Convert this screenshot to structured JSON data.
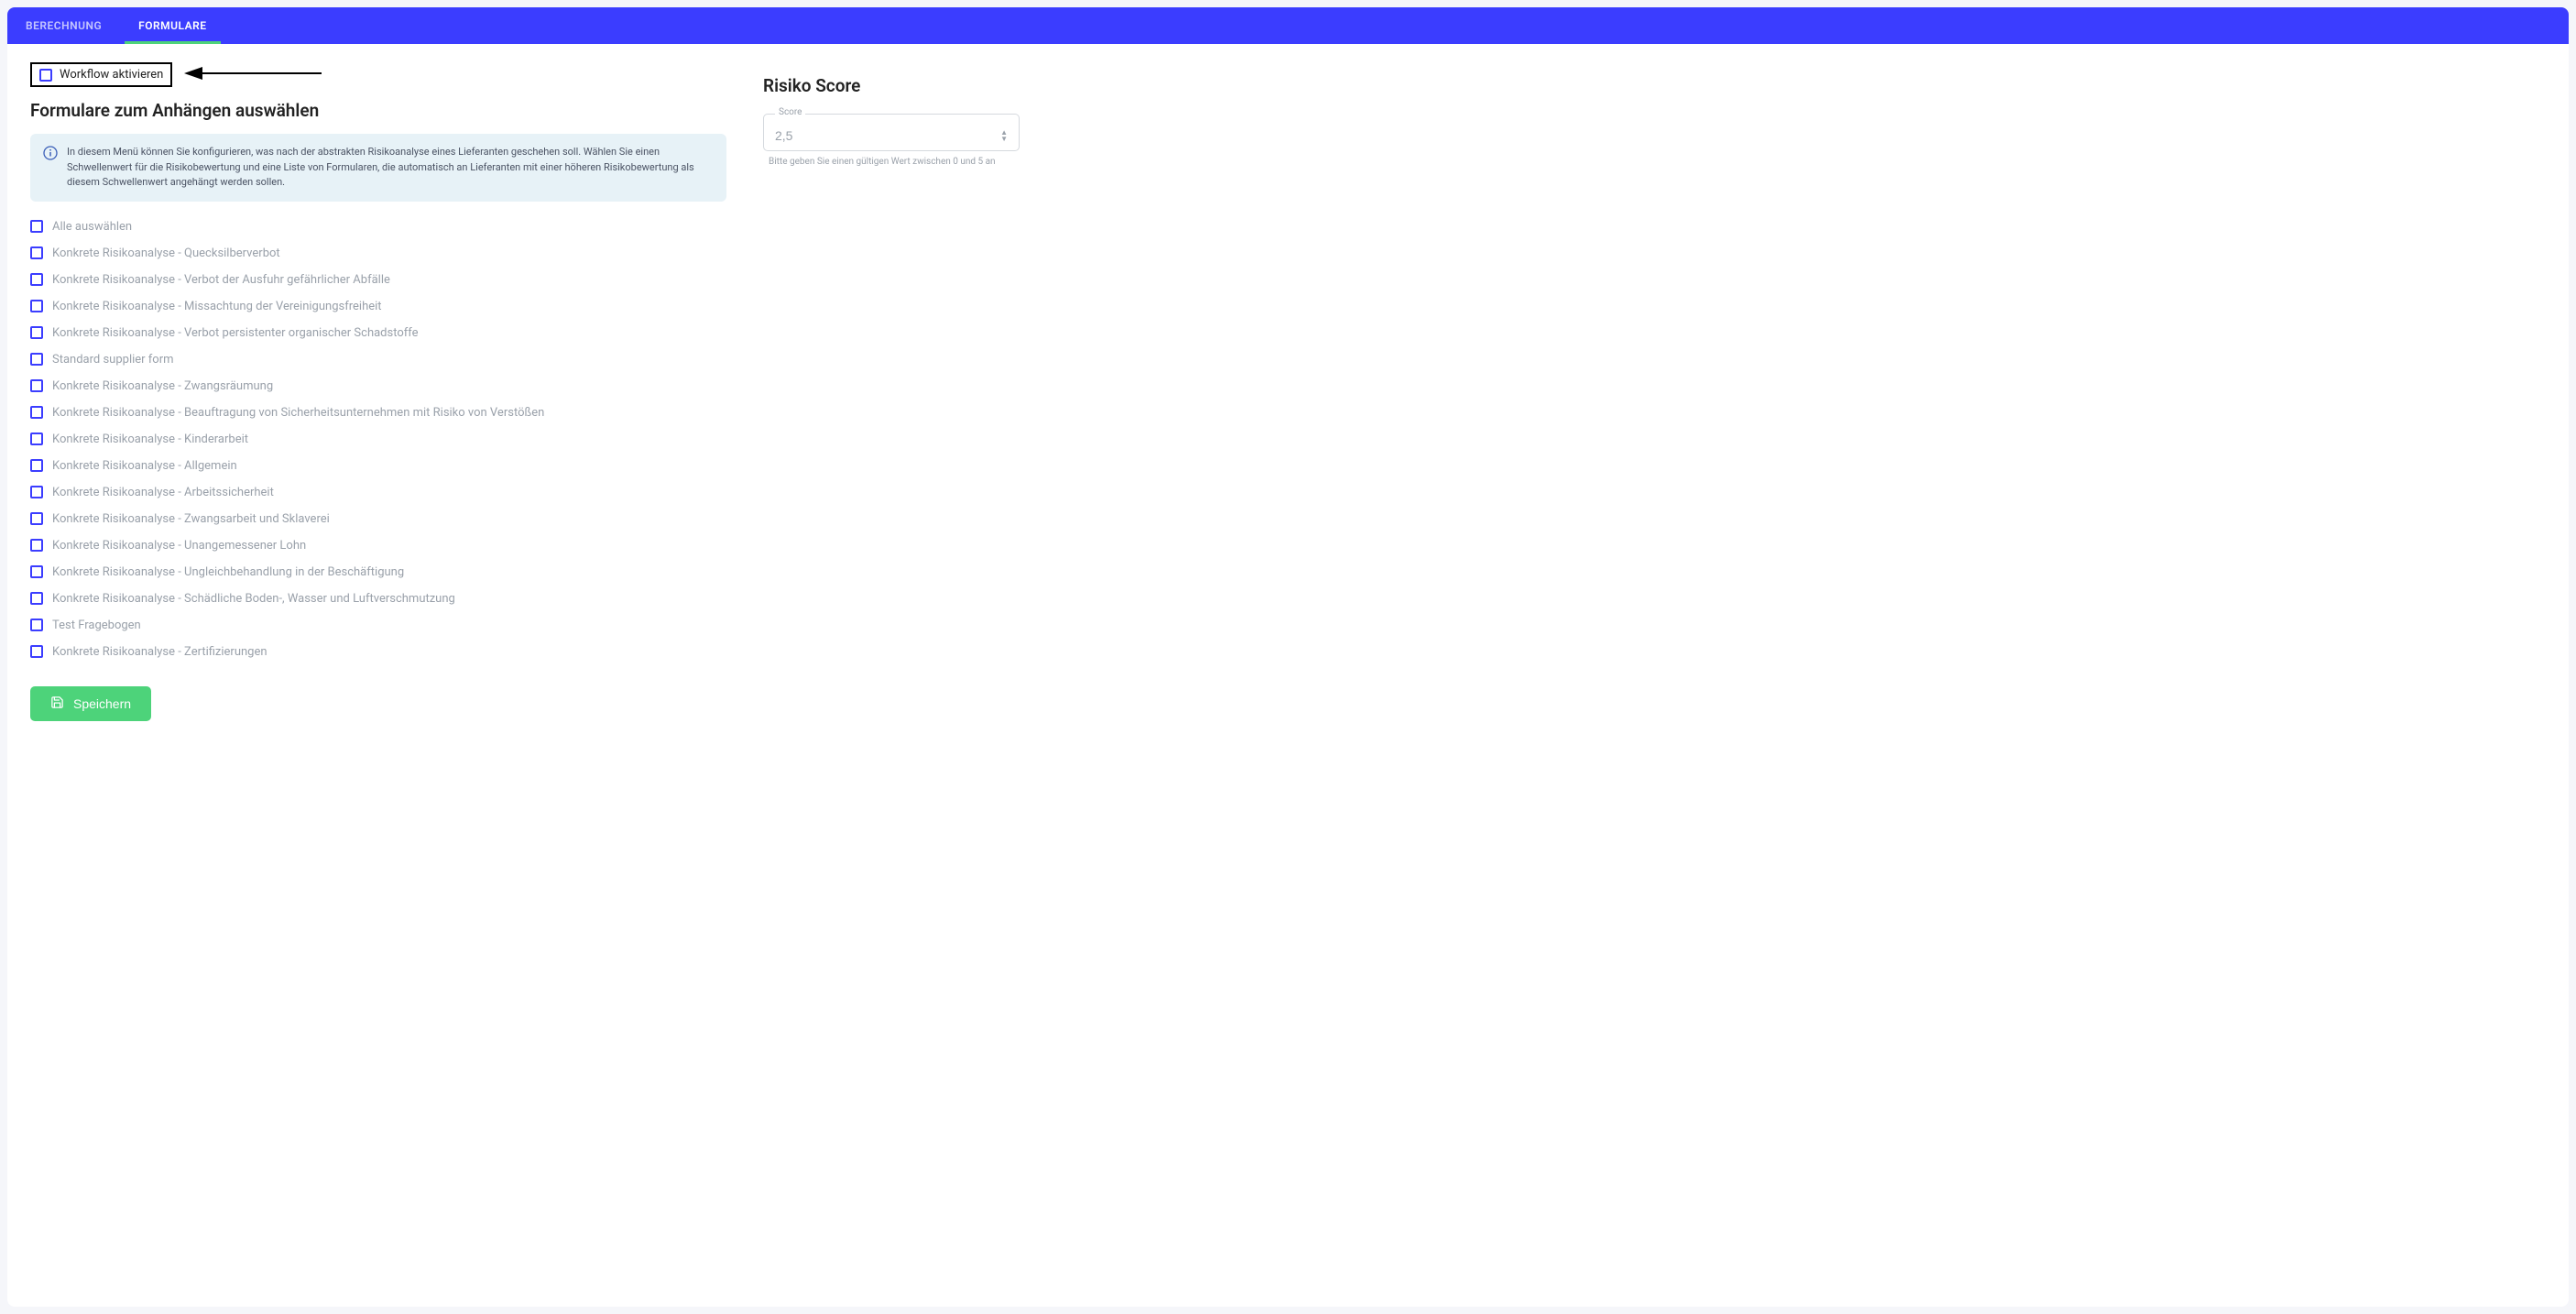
{
  "tabs": [
    {
      "label": "BERECHNUNG",
      "active": false
    },
    {
      "label": "FORMULARE",
      "active": true
    }
  ],
  "workflow": {
    "label": "Workflow aktivieren"
  },
  "forms_section": {
    "title": "Formulare zum Anhängen auswählen",
    "info": "In diesem Menü können Sie konfigurieren, was nach der abstrakten Risikoanalyse eines Lieferanten geschehen soll. Wählen Sie einen Schwellenwert für die Risikobewertung und eine Liste von Formularen, die automatisch an Lieferanten mit einer höheren Risikobewertung als diesem Schwellenwert angehängt werden sollen.",
    "items": [
      "Alle auswählen",
      "Konkrete Risikoanalyse - Quecksilberverbot",
      "Konkrete Risikoanalyse - Verbot der Ausfuhr gefährlicher Abfälle",
      "Konkrete Risikoanalyse - Missachtung der Vereinigungsfreiheit",
      "Konkrete Risikoanalyse - Verbot persistenter organischer Schadstoffe",
      "Standard supplier form",
      "Konkrete Risikoanalyse - Zwangsräumung",
      "Konkrete Risikoanalyse - Beauftragung von Sicherheitsunternehmen mit Risiko von Verstößen",
      "Konkrete Risikoanalyse - Kinderarbeit",
      "Konkrete Risikoanalyse - Allgemein",
      "Konkrete Risikoanalyse - Arbeitssicherheit",
      "Konkrete Risikoanalyse - Zwangsarbeit und Sklaverei",
      "Konkrete Risikoanalyse - Unangemessener Lohn",
      "Konkrete Risikoanalyse - Ungleichbehandlung in der Beschäftigung",
      "Konkrete Risikoanalyse - Schädliche Boden-, Wasser und Luftverschmutzung",
      "Test Fragebogen",
      "Konkrete Risikoanalyse - Zertifizierungen"
    ]
  },
  "score_section": {
    "title": "Risiko Score",
    "legend": "Score",
    "value": "2,5",
    "hint": "Bitte geben Sie einen gültigen Wert zwischen 0 und 5 an"
  },
  "save_button": {
    "label": "Speichern"
  }
}
